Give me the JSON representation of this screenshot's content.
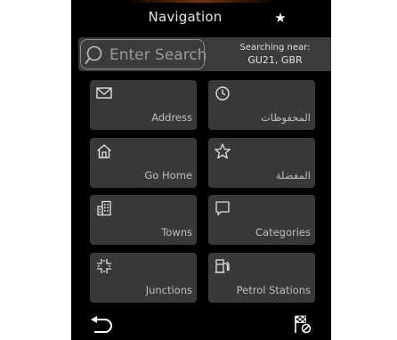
{
  "header": {
    "title": "Navigation",
    "favorite_icon": "star-icon"
  },
  "search": {
    "placeholder": "Enter Search",
    "near_label": "Searching near:",
    "near_location": "GU21, GBR"
  },
  "tiles": [
    {
      "label": "Address",
      "icon": "envelope-icon"
    },
    {
      "label": "المحفوظات",
      "icon": "clock-icon"
    },
    {
      "label": "Go Home",
      "icon": "home-icon"
    },
    {
      "label": "المفضلة",
      "icon": "star-outline-icon"
    },
    {
      "label": "Towns",
      "icon": "building-icon"
    },
    {
      "label": "Categories",
      "icon": "speech-bubble-icon"
    },
    {
      "label": "Junctions",
      "icon": "junction-icon"
    },
    {
      "label": "Petrol Stations",
      "icon": "fuel-pump-icon"
    }
  ],
  "footer": {
    "back_icon": "back-arrow-icon",
    "end_route_icon": "cancel-route-flag-icon"
  },
  "colors": {
    "background": "#000000",
    "tile": "#393939",
    "search_bar": "#3c3c3c",
    "text": "#bdbdbd",
    "title": "#e6e6e6"
  }
}
